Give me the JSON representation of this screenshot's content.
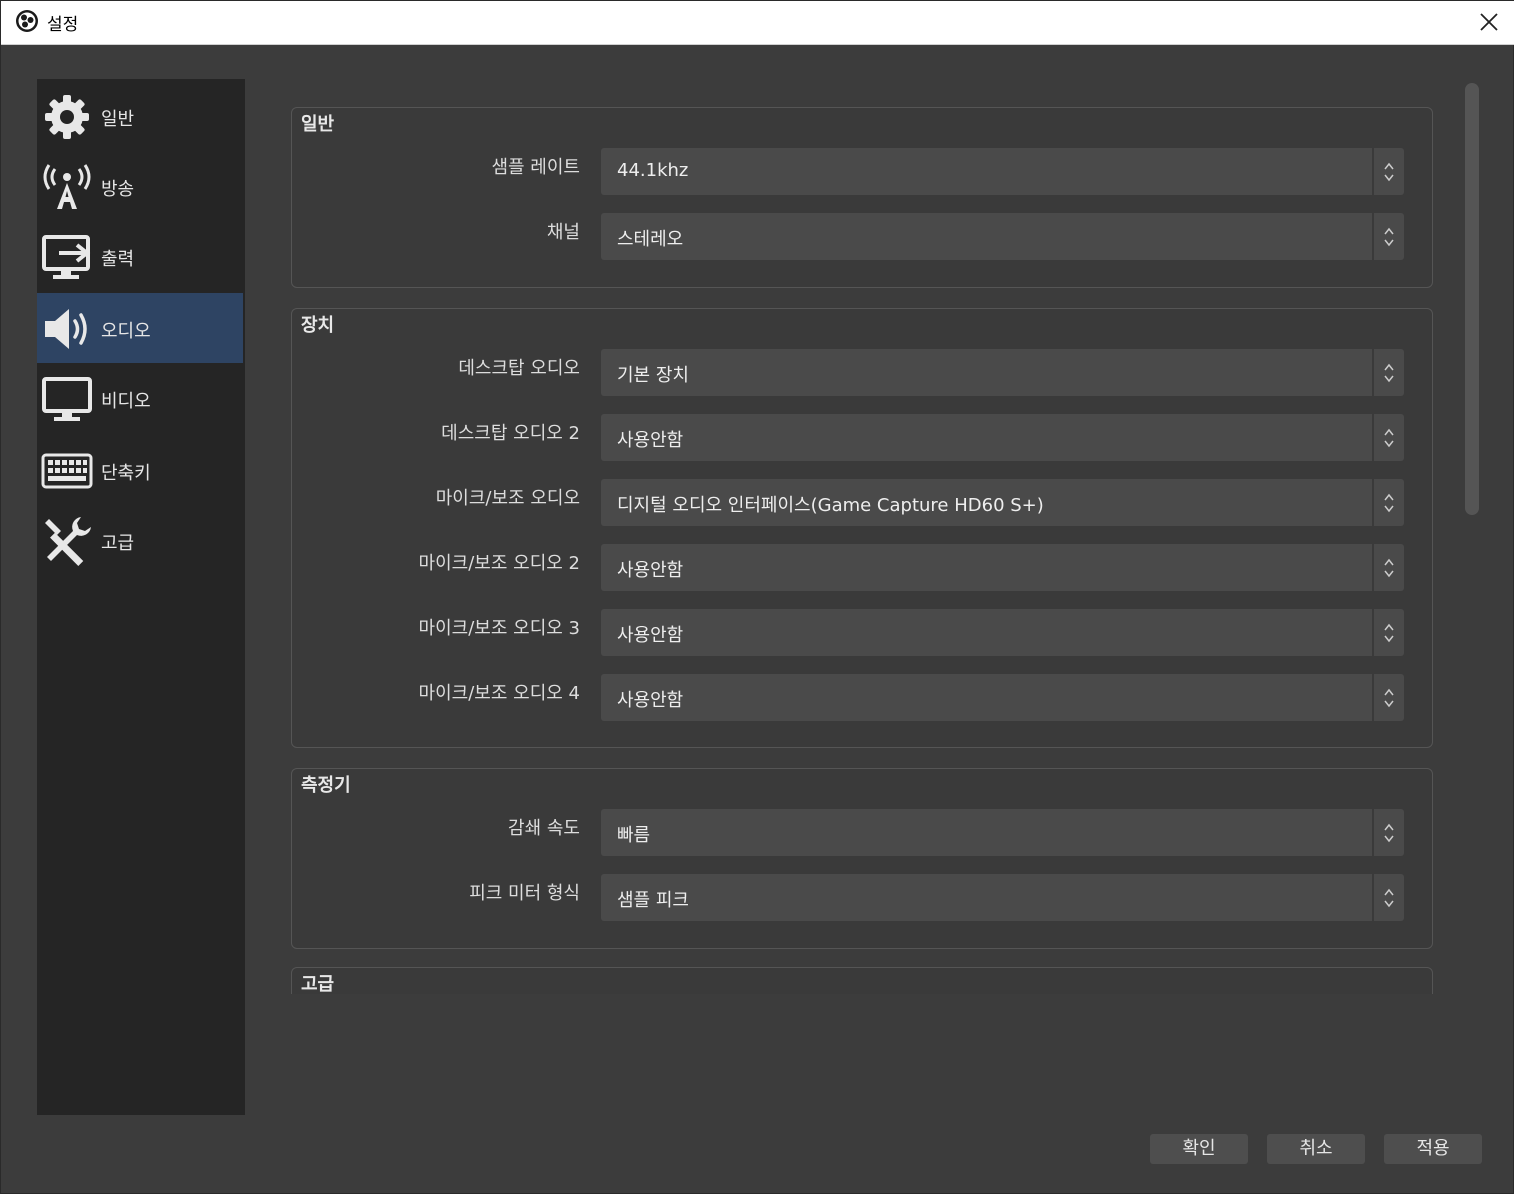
{
  "window": {
    "title": "설정",
    "close_icon": "close-icon"
  },
  "sidebar": {
    "items": [
      {
        "label": "일반",
        "icon": "gear-icon"
      },
      {
        "label": "방송",
        "icon": "broadcast-tower-icon"
      },
      {
        "label": "출력",
        "icon": "output-monitor-icon"
      },
      {
        "label": "오디오",
        "icon": "speaker-icon",
        "active": true
      },
      {
        "label": "비디오",
        "icon": "monitor-icon"
      },
      {
        "label": "단축키",
        "icon": "keyboard-icon"
      },
      {
        "label": "고급",
        "icon": "tools-icon"
      }
    ],
    "active_color": "#2e4463"
  },
  "groups": {
    "general": {
      "title": "일반",
      "rows": [
        {
          "label": "샘플 레이트",
          "value": "44.1khz"
        },
        {
          "label": "채널",
          "value": "스테레오"
        }
      ]
    },
    "devices": {
      "title": "장치",
      "rows": [
        {
          "label": "데스크탑 오디오",
          "value": "기본 장치"
        },
        {
          "label": "데스크탑 오디오 2",
          "value": "사용안함"
        },
        {
          "label": "마이크/보조 오디오",
          "value": "디지털 오디오 인터페이스(Game Capture HD60 S+)"
        },
        {
          "label": "마이크/보조 오디오 2",
          "value": "사용안함"
        },
        {
          "label": "마이크/보조 오디오 3",
          "value": "사용안함"
        },
        {
          "label": "마이크/보조 오디오 4",
          "value": "사용안함"
        }
      ]
    },
    "meters": {
      "title": "측정기",
      "rows": [
        {
          "label": "감쇄 속도",
          "value": "빠름"
        },
        {
          "label": "피크 미터 형식",
          "value": "샘플 피크"
        }
      ]
    },
    "advanced": {
      "title": "고급"
    }
  },
  "buttons": {
    "ok": "확인",
    "cancel": "취소",
    "apply": "적용"
  }
}
